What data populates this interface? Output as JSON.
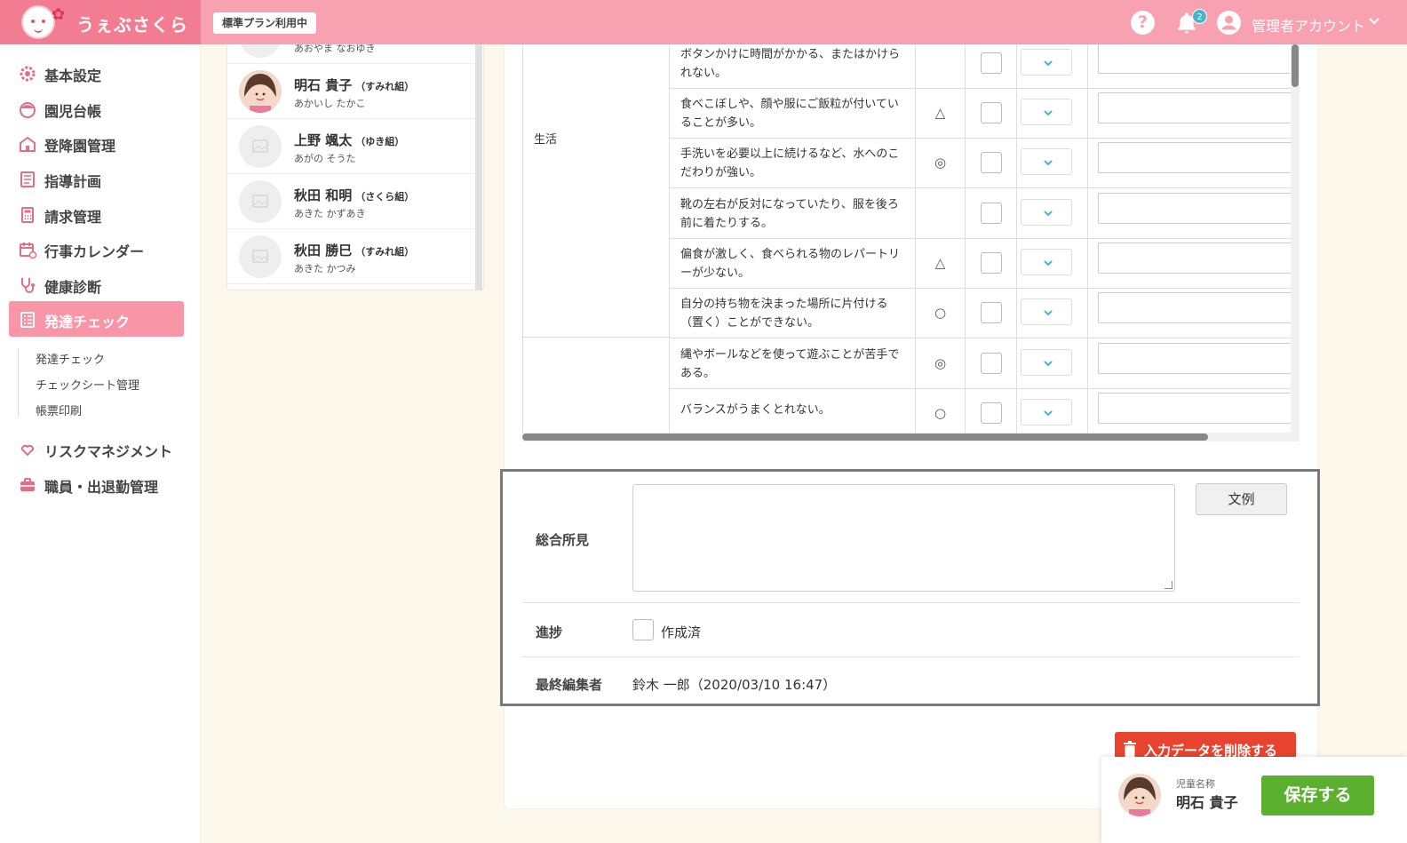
{
  "header": {
    "logo_text": "うぇぶさくら",
    "plan_badge": "標準プラン利用中",
    "notification_count": "2",
    "user_name": "管理者アカウント",
    "accent": "#f8a2b1"
  },
  "sidebar": {
    "items": [
      {
        "label": "基本設定",
        "icon": "gear-icon"
      },
      {
        "label": "園児台帳",
        "icon": "child-icon"
      },
      {
        "label": "登降園管理",
        "icon": "school-icon"
      },
      {
        "label": "指導計画",
        "icon": "notebook-icon"
      },
      {
        "label": "請求管理",
        "icon": "calculator-icon"
      },
      {
        "label": "行事カレンダー",
        "icon": "calendar-icon"
      },
      {
        "label": "健康診断",
        "icon": "stethoscope-icon"
      },
      {
        "label": "発達チェック",
        "icon": "checklist-icon",
        "active": true
      },
      {
        "label": "リスクマネジメント",
        "icon": "heart-hands-icon"
      },
      {
        "label": "職員・出退勤管理",
        "icon": "briefcase-icon"
      }
    ],
    "sub_items": [
      "発達チェック",
      "チェックシート管理",
      "帳票印刷"
    ]
  },
  "children": [
    {
      "name": "",
      "class": "",
      "kana": "あおやま なおゆき"
    },
    {
      "name": "明石 貴子",
      "class": "（すみれ組）",
      "kana": "あかいし たかこ",
      "photo": true
    },
    {
      "name": "上野 颯太",
      "class": "（ゆき組）",
      "kana": "あがの そうた"
    },
    {
      "name": "秋田 和明",
      "class": "（さくら組）",
      "kana": "あきた かずあき"
    },
    {
      "name": "秋田 勝巳",
      "class": "（すみれ組）",
      "kana": "あきた かつみ"
    }
  ],
  "table": {
    "category": "生活",
    "rows": [
      {
        "question": "ボタンかけに時間がかかる、またはかけられない。",
        "mark": ""
      },
      {
        "question": "食べこぼしや、顔や服にご飯粒が付いていることが多い。",
        "mark": "△"
      },
      {
        "question": "手洗いを必要以上に続けるなど、水へのこだわりが強い。",
        "mark": "◎"
      },
      {
        "question": "靴の左右が反対になっていたり、服を後ろ前に着たりする。",
        "mark": ""
      },
      {
        "question": "偏食が激しく、食べられる物のレパートリーが少ない。",
        "mark": "△"
      },
      {
        "question": "自分の持ち物を決まった場所に片付ける（置く）ことができない。",
        "mark": "○"
      },
      {
        "question": "縄やボールなどを使って遊ぶことが苦手である。",
        "mark": "◎"
      },
      {
        "question": "バランスがうまくとれない。",
        "mark": "○"
      }
    ]
  },
  "summary": {
    "overall_label": "総合所見",
    "overall_value": "",
    "example_button": "文例",
    "progress_label": "進捗",
    "progress_checkbox": "作成済",
    "editor_label": "最終編集者",
    "editor_value": "鈴木 一郎（2020/03/10 16:47）"
  },
  "actions": {
    "delete_button": "入力データを削除する",
    "delete_color": "#e8432e",
    "save_button": "保存する",
    "save_color": "#5bb030"
  },
  "footer": {
    "child_label": "児童名称",
    "child_name": "明石 貴子"
  }
}
